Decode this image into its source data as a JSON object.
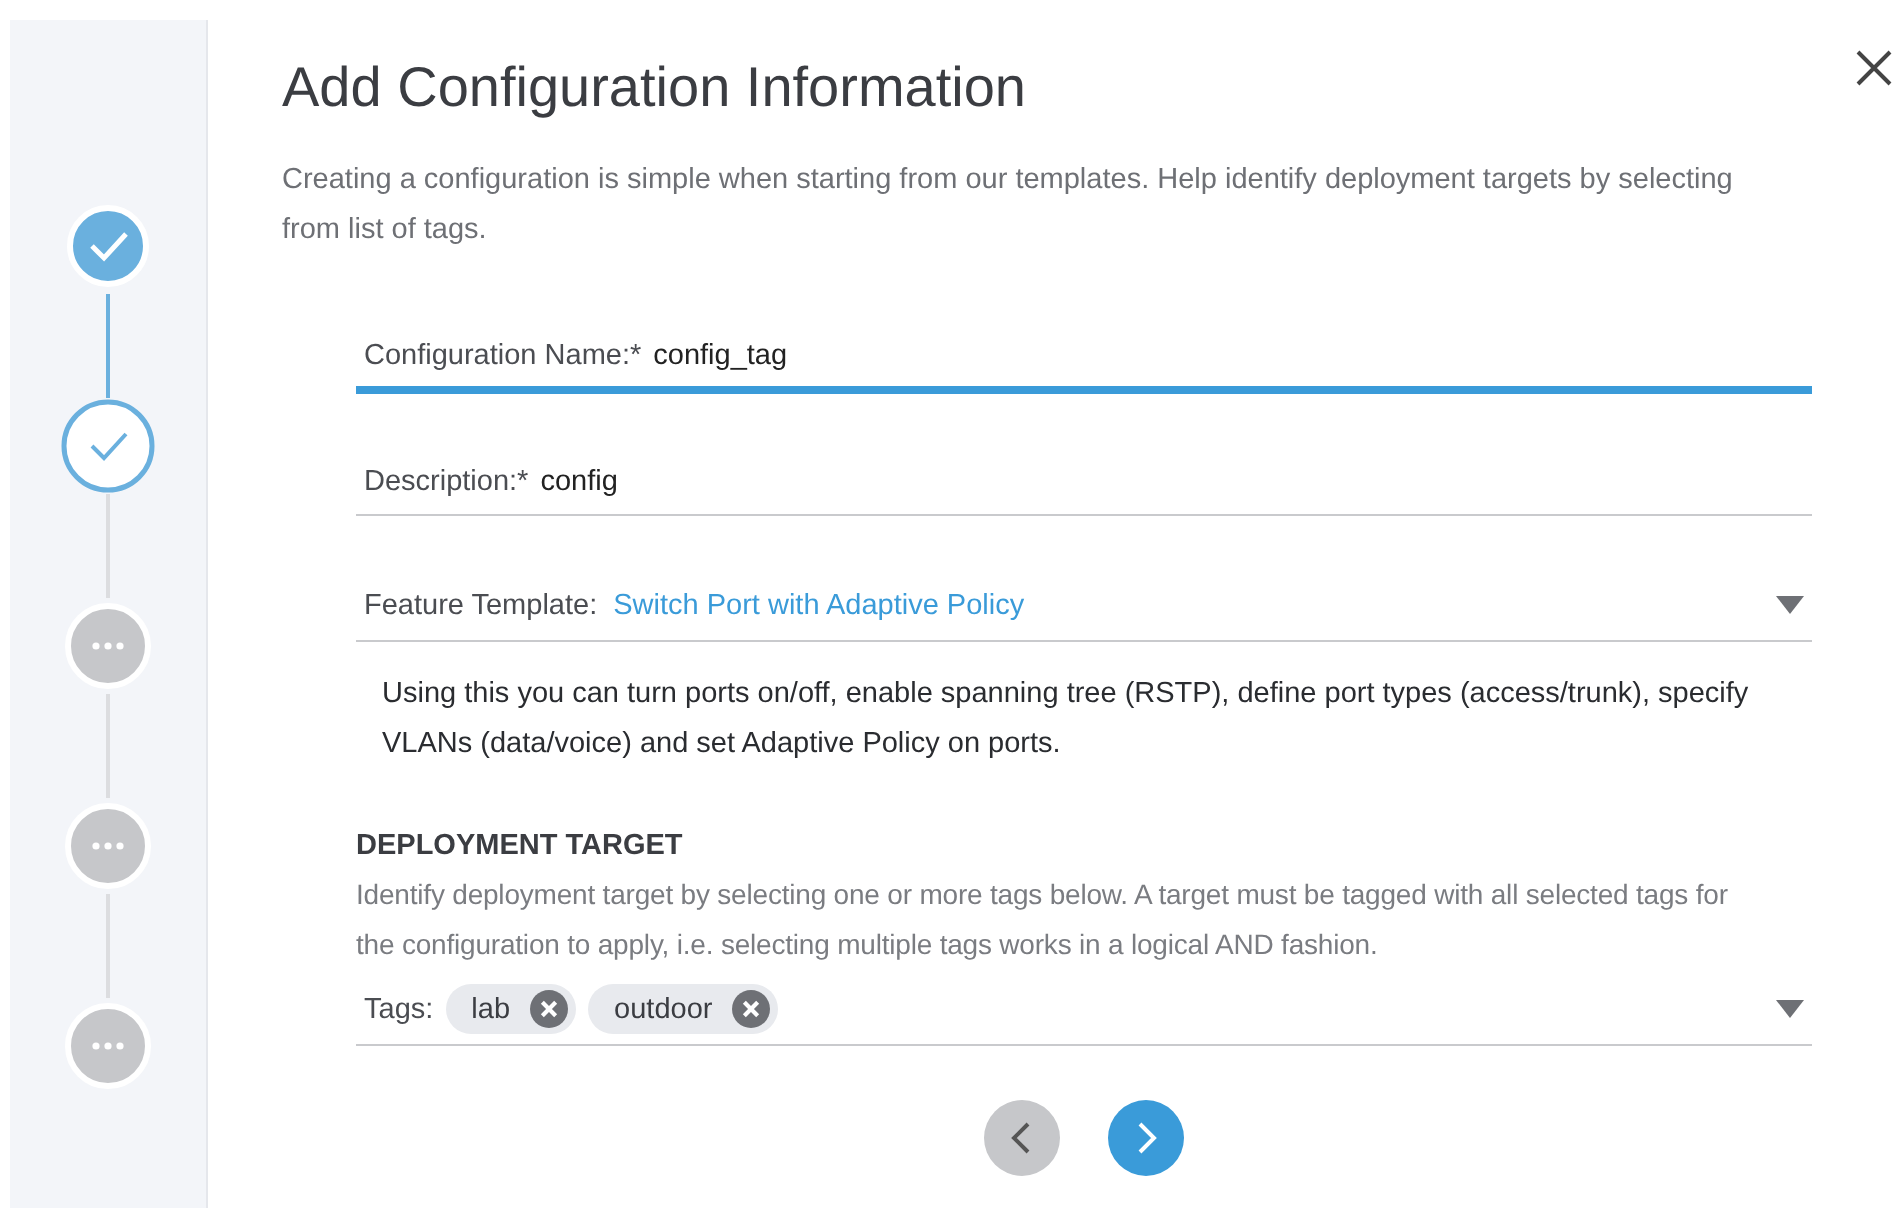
{
  "steps": [
    {
      "kind": "done"
    },
    {
      "kind": "current"
    },
    {
      "kind": "pending"
    },
    {
      "kind": "pending"
    },
    {
      "kind": "pending"
    }
  ],
  "title": "Add Configuration Information",
  "intro": "Creating a configuration is simple when starting from our templates. Help identify deployment targets by selecting from list of tags.",
  "fields": [
    {
      "label": "Configuration Name:*",
      "value": "config_tag",
      "focused": true
    },
    {
      "label": "Description:*",
      "value": "config",
      "focused": false
    }
  ],
  "feature_template": {
    "label": "Feature Template:",
    "value": "Switch Port with Adaptive Policy",
    "help": "Using this you can turn ports on/off, enable spanning tree (RSTP), define port types (access/trunk), specify VLANs (data/voice) and set Adaptive Policy on ports."
  },
  "deployment_target": {
    "heading": "DEPLOYMENT TARGET",
    "description": "Identify deployment target by selecting one or more tags below. A target must be tagged with all selected tags for the configuration to apply, i.e. selecting multiple tags works in a logical AND fashion.",
    "tags_label": "Tags:",
    "tags": [
      "lab",
      "outdoor"
    ]
  },
  "nav": {
    "back_disabled": true
  }
}
